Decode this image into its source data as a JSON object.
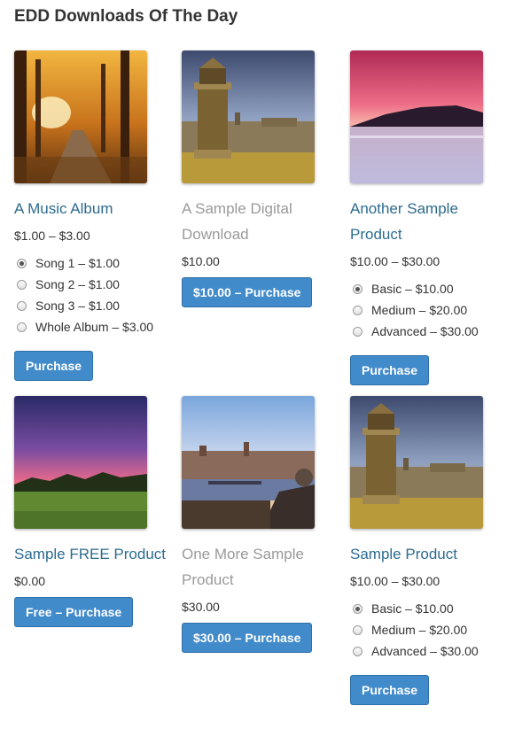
{
  "page": {
    "title": "EDD Downloads Of The Day"
  },
  "products": [
    {
      "name": "A Music Album",
      "price": "$1.00 – $3.00",
      "image": "autumn-path-photo",
      "options": [
        {
          "label": "Song 1 – $1.00",
          "checked": true
        },
        {
          "label": "Song 2 – $1.00",
          "checked": false
        },
        {
          "label": "Song 3 – $1.00",
          "checked": false
        },
        {
          "label": "Whole Album – $3.00",
          "checked": false
        }
      ],
      "button": "Purchase"
    },
    {
      "name": "A Sample Digital Download",
      "price": "$10.00",
      "image": "monument-city-photo",
      "button": "$10.00 – Purchase"
    },
    {
      "name": "Another Sample Product",
      "price": "$10.00 – $30.00",
      "image": "sunset-lake-photo",
      "options": [
        {
          "label": "Basic – $10.00",
          "checked": true
        },
        {
          "label": "Medium – $20.00",
          "checked": false
        },
        {
          "label": "Advanced – $30.00",
          "checked": false
        }
      ],
      "button": "Purchase"
    },
    {
      "name": "Sample FREE Product",
      "price": "$0.00",
      "image": "purple-sky-field-photo",
      "button": "Free – Purchase"
    },
    {
      "name": "One More Sample Product",
      "price": "$30.00",
      "image": "river-city-photo",
      "button": "$30.00 – Purchase"
    },
    {
      "name": "Sample Product",
      "price": "$10.00 – $30.00",
      "image": "monument-city-photo",
      "options": [
        {
          "label": "Basic – $10.00",
          "checked": true
        },
        {
          "label": "Medium – $20.00",
          "checked": false
        },
        {
          "label": "Advanced – $30.00",
          "checked": false
        }
      ],
      "button": "Purchase"
    }
  ]
}
